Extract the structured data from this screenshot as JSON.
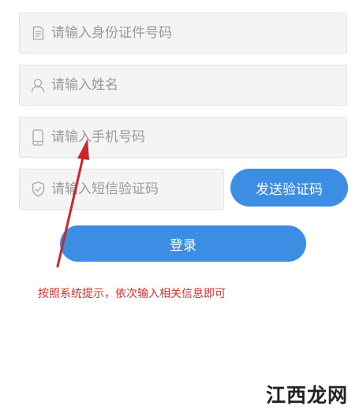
{
  "form": {
    "id_number": {
      "icon": "document-icon",
      "placeholder": "请输入身份证件号码",
      "value": ""
    },
    "name": {
      "icon": "user-icon",
      "placeholder": "请输入姓名",
      "value": ""
    },
    "phone": {
      "icon": "mobile-phone-icon",
      "placeholder": "请输入手机号码",
      "value": ""
    },
    "sms_code": {
      "icon": "shield-check-icon",
      "placeholder": "请输入短信验证码",
      "value": ""
    },
    "send_code_label": "发送验证码",
    "login_label": "登录"
  },
  "annotation": {
    "hint_text": "按照系统提示，依次输入相关信息即可",
    "color": "#d0312d"
  },
  "watermark": {
    "text": "江西龙网"
  },
  "colors": {
    "primary_button": "#3b8ee3",
    "field_background": "#f4f4f4",
    "placeholder": "#9a9a9a"
  }
}
